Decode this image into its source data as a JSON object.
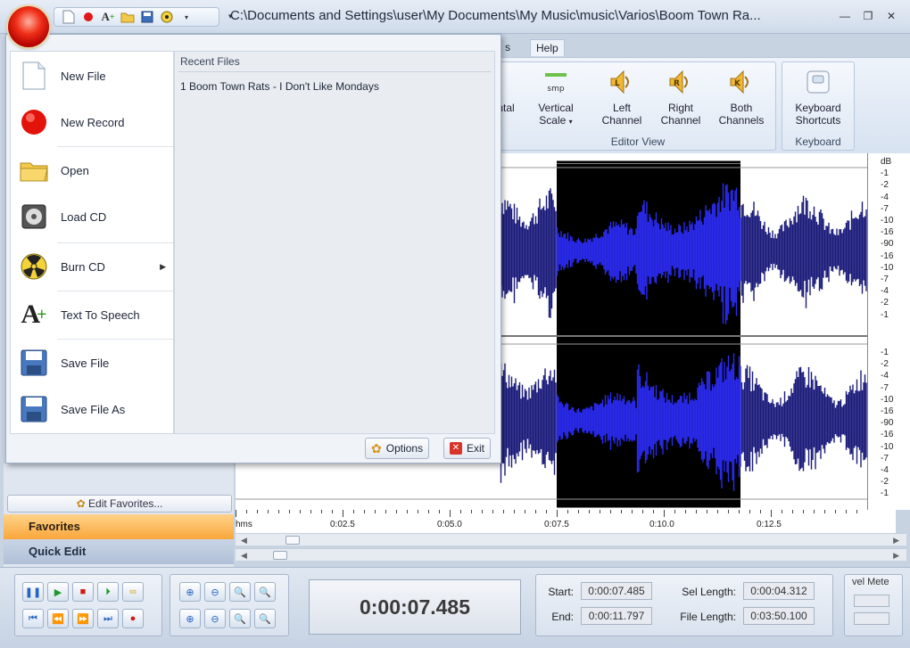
{
  "window": {
    "title": "C:\\Documents and Settings\\user\\My Documents\\My Music\\music\\Varios\\Boom Town Ra..."
  },
  "ribbon": {
    "tabs": [
      {
        "label": "s"
      },
      {
        "label": "Help"
      }
    ],
    "groups": [
      {
        "label": "Editor View",
        "buttons": [
          {
            "label_line1": "ntal",
            "label_line2": "",
            "icon": "horizontal-scale-icon"
          },
          {
            "label_line1": "Vertical",
            "label_line2": "Scale",
            "icon": "vertical-scale-icon",
            "icon_text": "smp"
          },
          {
            "label_line1": "Left",
            "label_line2": "Channel",
            "icon": "left-channel-icon",
            "icon_text": "L"
          },
          {
            "label_line1": "Right",
            "label_line2": "Channel",
            "icon": "right-channel-icon",
            "icon_text": "R"
          },
          {
            "label_line1": "Both",
            "label_line2": "Channels",
            "icon": "both-channels-icon",
            "icon_text": "K"
          }
        ]
      },
      {
        "label": "Keyboard",
        "buttons": [
          {
            "label_line1": "Keyboard",
            "label_line2": "Shortcuts",
            "icon": "keyboard-icon"
          }
        ]
      }
    ]
  },
  "app_menu": {
    "items": [
      {
        "label": "New File",
        "icon": "new-file-icon"
      },
      {
        "label": "New Record",
        "icon": "record-icon"
      },
      {
        "label": "Open",
        "icon": "folder-icon"
      },
      {
        "label": "Load CD",
        "icon": "cd-icon"
      },
      {
        "label": "Burn CD",
        "icon": "burn-icon"
      },
      {
        "label": "Text To Speech",
        "icon": "text-to-speech-icon"
      },
      {
        "label": "Save File",
        "icon": "save-icon"
      },
      {
        "label": "Save File As",
        "icon": "save-as-icon"
      }
    ],
    "recent_title": "Recent Files",
    "recent_files": [
      "1 Boom Town Rats - I Don't Like Mondays"
    ],
    "options_label": "Options",
    "exit_label": "Exit"
  },
  "waveform": {
    "db_top": [
      "dB",
      "-1",
      "-2",
      "-4",
      "-7",
      "-10",
      "-16",
      "-90",
      "-16",
      "-10",
      "-7",
      "-4",
      "-2",
      "-1"
    ],
    "db_bottom": [
      "-1",
      "-2",
      "-4",
      "-7",
      "-10",
      "-16",
      "-90",
      "-16",
      "-10",
      "-7",
      "-4",
      "-2",
      "-1"
    ],
    "timeline": [
      "hms",
      "0:02.5",
      "0:05.0",
      "0:07.5",
      "0:10.0",
      "0:12.5"
    ],
    "selection_start_s": 7.485,
    "selection_end_s": 11.797
  },
  "left_panel": {
    "edit_favorites": "Edit Favorites...",
    "favorites": "Favorites",
    "quick_edit": "Quick Edit"
  },
  "transport": {
    "current_time": "0:00:07.485"
  },
  "selection_info": {
    "start_label": "Start:",
    "start_value": "0:00:07.485",
    "end_label": "End:",
    "end_value": "0:00:11.797",
    "sel_length_label": "Sel Length:",
    "sel_length_value": "0:00:04.312",
    "file_length_label": "File Length:",
    "file_length_value": "0:03:50.100"
  },
  "level_meter": {
    "label": "vel Mete"
  },
  "colors": {
    "waveform": "#1a1a7a",
    "selected_waveform": "#2a2af0",
    "selection_bg": "#000000",
    "favorites_bg": "#f9a63b"
  }
}
